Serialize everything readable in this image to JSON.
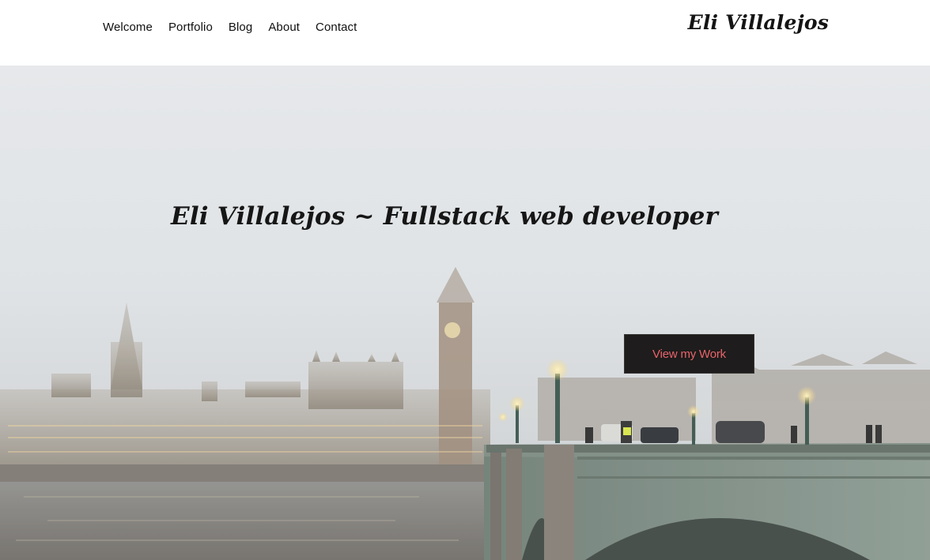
{
  "nav": {
    "items": [
      {
        "label": "Welcome"
      },
      {
        "label": "Portfolio"
      },
      {
        "label": "Blog"
      },
      {
        "label": "About"
      },
      {
        "label": "Contact"
      }
    ]
  },
  "brand": {
    "name": "Eli Villalejos"
  },
  "hero": {
    "headline": "Eli Villalejos ~ Fullstack web developer",
    "cta_label": "View my Work",
    "background_image": "foggy-london-westminster-bridge-photo"
  },
  "colors": {
    "header_bg": "#ffffff",
    "nav_text": "#111111",
    "cta_bg": "#1e1c1c",
    "cta_text": "#e8646a",
    "fog": "#d9dde0"
  }
}
